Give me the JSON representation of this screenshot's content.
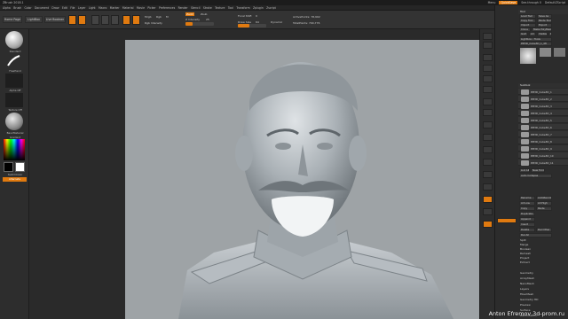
{
  "titlebar": {
    "title": "ZBrush 2018.1",
    "menu_text": "Menu",
    "quicksave": "QuickSave",
    "layout": "DefaultZScript",
    "see_through": "See-through 0"
  },
  "menubar": {
    "items": [
      "Alpha",
      "Brush",
      "Color",
      "Document",
      "Draw",
      "Edit",
      "File",
      "Layer",
      "Light",
      "Macro",
      "Marker",
      "Material",
      "Movie",
      "Picker",
      "Preferences",
      "Render",
      "Stencil",
      "Stroke",
      "Texture",
      "Tool",
      "Transform",
      "Zplugin",
      "Zscript"
    ]
  },
  "shelf": {
    "home_page": "Home Page",
    "lightbox": "LightBox",
    "live_boolean": "Live Boolean",
    "edit": "Edit",
    "draw": "Draw",
    "move": "Move",
    "scale": "Scale",
    "rotate": "Rotate",
    "mrgb": "Mrgb",
    "rgb": "Rgb",
    "m": "M",
    "zadd": "Zadd",
    "zsub": "Zsub",
    "focal_shift_label": "Focal Shift",
    "focal_shift_value": "0",
    "draw_size_label": "Draw Size",
    "draw_size_value": "64",
    "z_intensity_label": "Z Intensity",
    "z_intensity_value": "25",
    "rgb_intensity_label": "Rgb Intensity",
    "rgb_intensity_value": "100",
    "active_points": "ActivePoints: 78,992",
    "total_points": "TotalPoints: 790,776",
    "dynamic": "Dynamic"
  },
  "leftshelf": {
    "standard": "Standard",
    "freehand": "FreeHand",
    "alpha_off": "Alpha Off",
    "texture_off": "Texture Off",
    "basic_material": "BasicMaterial",
    "gradient": "Gradient",
    "switch_color": "SwitchColor",
    "alternate": "Alternate"
  },
  "tray": {
    "tool_title": "Tool",
    "load_tool": "Load Tool",
    "save_as": "Save As",
    "copy_tool": "Copy Tool",
    "paste_tool": "Paste Tool",
    "import": "Import",
    "export": "Export",
    "clone": "Clone",
    "make_polymesh3d": "Make PolyMesh3D",
    "goz": "GoZ",
    "all": "All",
    "visible": "Visible",
    "r": "R",
    "lightbox_tools": "Lightbox › Tools",
    "current_tool": "PM3D_Cube3D_1_48",
    "subtool_title": "Subtool",
    "subtools": [
      "PM3D_Cube3D_1",
      "PM3D_Cube3D_2",
      "PM3D_Cube3D_3",
      "PM3D_Cube3D_4",
      "PM3D_Cube3D_5",
      "PM3D_Cube3D_6",
      "PM3D_Cube3D_7",
      "PM3D_Cube3D_8",
      "PM3D_Cube3D_9",
      "PM3D_Cube3D_10",
      "PM3D_Cube3D_11"
    ],
    "list_all": "List All",
    "new_folder": "New Folder",
    "auto_collapse": "Auto Collapse",
    "rename": "Rename",
    "autoreorder": "AutoReorder",
    "all_low": "All Low",
    "all_high": "All High",
    "copy": "Copy",
    "paste": "Paste",
    "duplicate": "Duplicate",
    "append": "Append",
    "insert": "Insert",
    "delete": "Delete",
    "del_other": "Del Other",
    "del_all": "Del All",
    "split": "Split",
    "merge": "Merge",
    "boolean": "Boolean",
    "remesh": "Remesh",
    "project": "Project",
    "extract": "Extract",
    "menu_items": [
      "Geometry",
      "ArrayMesh",
      "NanoMesh",
      "Layers",
      "FiberMesh",
      "Geometry HD",
      "Preview",
      "Surface",
      "Deformation"
    ]
  },
  "watermark": "Anton Efremov 3d-prom.ru"
}
